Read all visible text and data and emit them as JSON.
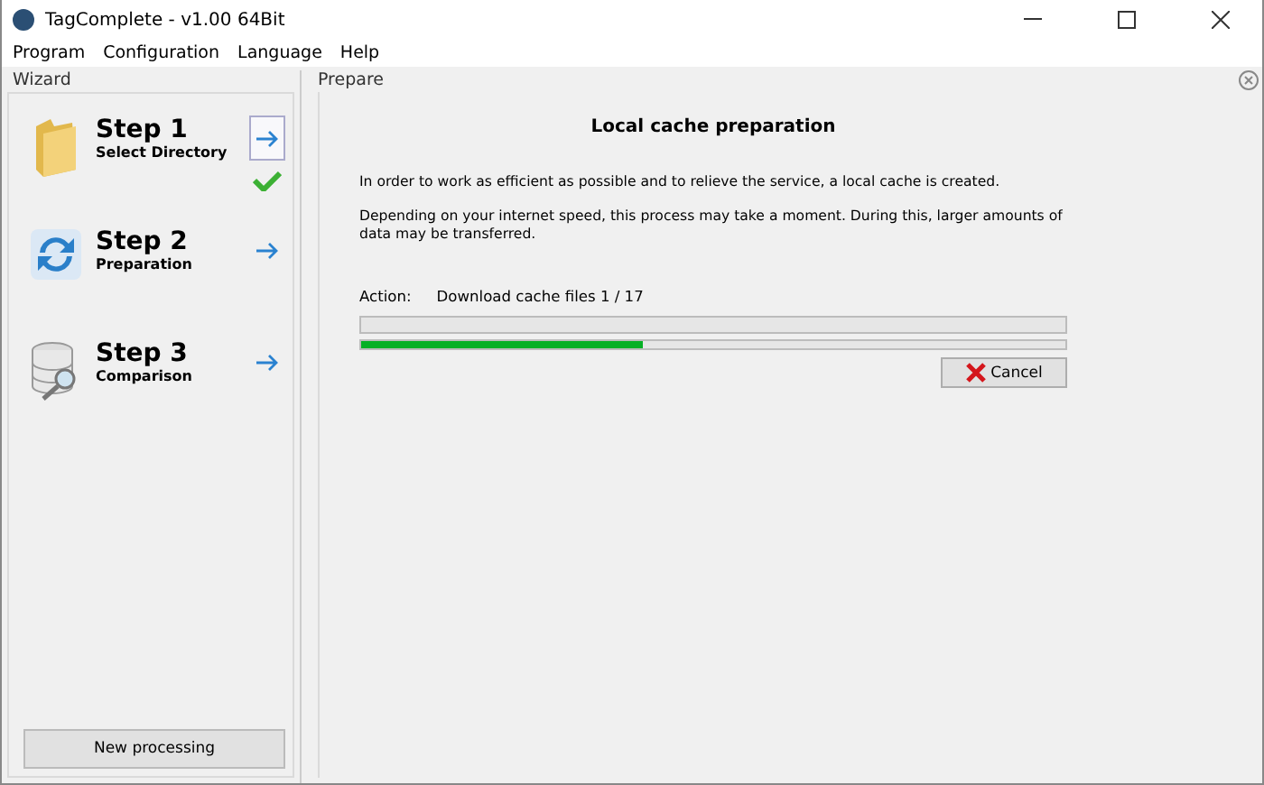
{
  "window": {
    "title": "TagComplete - v1.00 64Bit"
  },
  "menu": [
    "Program",
    "Configuration",
    "Language",
    "Help"
  ],
  "wizard": {
    "title": "Wizard",
    "steps": [
      {
        "kind": "folder",
        "title": "Step 1",
        "subtitle": "Select Directory",
        "selected": true,
        "done": true
      },
      {
        "kind": "refresh",
        "title": "Step 2",
        "subtitle": "Preparation",
        "selected": false,
        "done": false
      },
      {
        "kind": "database",
        "title": "Step 3",
        "subtitle": "Comparison",
        "selected": false,
        "done": false
      }
    ],
    "button": "New processing"
  },
  "prepare": {
    "title": "Prepare",
    "heading": "Local cache preparation",
    "paragraphs": [
      "In order to work as efficient as possible and to relieve the service, a local cache is created.",
      "Depending on your internet speed, this process may take a moment. During this,  larger amounts of data may be transferred."
    ],
    "action_label": "Action:",
    "action": "Download cache files 1 / 17",
    "progress": [
      {
        "level": 0
      },
      {
        "level": 0.4
      }
    ],
    "cancel": "Cancel"
  }
}
